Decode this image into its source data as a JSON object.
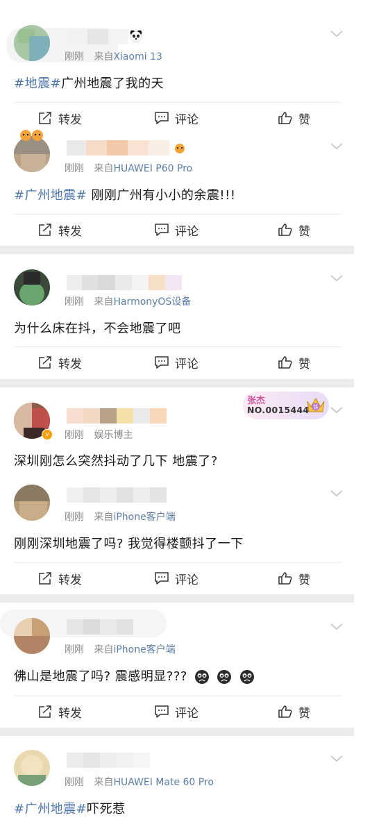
{
  "actions": {
    "repost_label": "转发",
    "comment_label": "评论",
    "like_label": "赞"
  },
  "posts": [
    {
      "time": "刚刚",
      "source_prefix": "来自",
      "source": "Xiaomi 13",
      "content_tag": "#地震#",
      "content_text": "广州地震了我的天",
      "has_actions": true
    },
    {
      "time": "刚刚",
      "source_prefix": "来自",
      "source": "HUAWEI P60 Pro",
      "content_tag": "#广州地震#",
      "content_text": " 刚刚广州有小小的余震!!!",
      "has_actions": true
    },
    {
      "time": "刚刚",
      "source_prefix": "来自",
      "source": "HarmonyOS设备",
      "content_tag": "",
      "content_text": "为什么床在抖，不会地震了吧",
      "has_actions": true
    },
    {
      "time": "刚刚",
      "source_prefix": "",
      "source": "娱乐博主",
      "content_tag": "",
      "content_text": "深圳刚怎么突然抖动了几下 地震了?",
      "has_actions": false,
      "medal": {
        "name": "张杰",
        "number": "NO.0015444",
        "badge": "铁"
      }
    },
    {
      "time": "刚刚",
      "source_prefix": "来自",
      "source": "iPhone客户端",
      "content_tag": "",
      "content_text": "刚刚深圳地震了吗? 我觉得楼颤抖了一下",
      "has_actions": true
    },
    {
      "time": "刚刚",
      "source_prefix": "来自",
      "source": "iPhone客户端",
      "content_tag": "",
      "content_text": "佛山是地震了吗? 震感明显???",
      "has_actions": true
    },
    {
      "time": "刚刚",
      "source_prefix": "来自",
      "source": "HUAWEI Mate 60 Pro",
      "content_tag": "#广州地震#",
      "content_text": "吓死惹",
      "has_actions": false
    }
  ],
  "colors": {
    "link": "#4d76ad",
    "source": "#5c7ea8",
    "meta": "#8a8a8a",
    "separator": "#ececec"
  },
  "icons": [
    "repost-icon",
    "comment-icon",
    "like-icon",
    "chevron-down-icon",
    "panda-emoji-icon",
    "tiger-emoji-icon",
    "crying-emoji-icon",
    "crown-icon"
  ]
}
